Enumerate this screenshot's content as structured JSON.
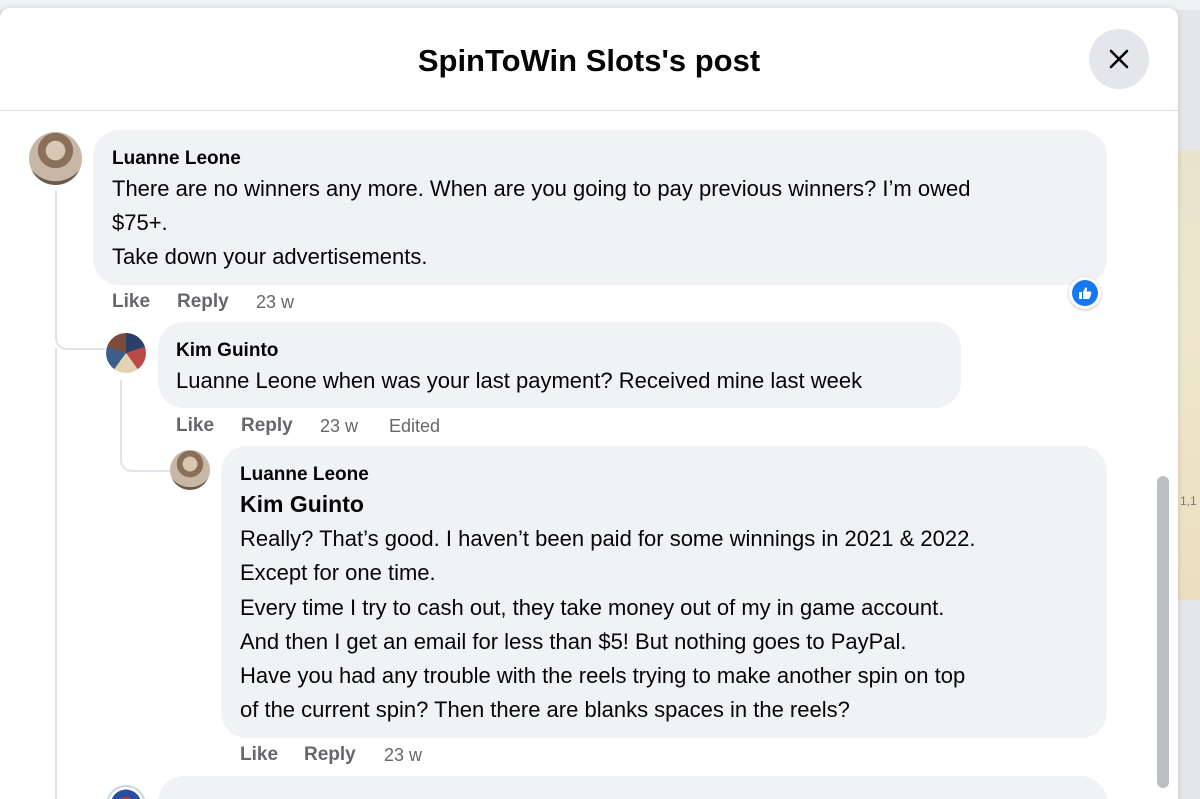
{
  "modal": {
    "title": "SpinToWin Slots's post"
  },
  "comments": [
    {
      "author": "Luanne Leone",
      "lines": [
        "There are no winners any more. When are you going to pay previous winners? I’m owed",
        "$75+.",
        "Take down your advertisements."
      ],
      "actions": {
        "like": "Like",
        "reply": "Reply"
      },
      "time": "23 w",
      "reaction": "like-reaction"
    },
    {
      "author": "Kim Guinto",
      "lines": [
        "Luanne Leone when was your last payment? Received mine last week"
      ],
      "actions": {
        "like": "Like",
        "reply": "Reply"
      },
      "time": "23 w",
      "edited": "Edited"
    },
    {
      "author": "Luanne Leone",
      "mention": "Kim Guinto",
      "lines": [
        "Really? That’s good. I haven’t been paid for some winnings in 2021 & 2022.",
        "Except for one time.",
        "Every time I try to cash out, they take money out of my in game account.",
        "And then I get an email for less than $5! But nothing goes to PayPal.",
        "Have you had any trouble with the reels trying to make another spin on top",
        "of the current spin? Then there are blanks spaces in the reels?"
      ],
      "actions": {
        "like": "Like",
        "reply": "Reply"
      },
      "time": "23 w"
    }
  ],
  "colors": {
    "bubble": "#f0f2f5",
    "secondary_text": "#65676b",
    "like_blue": "#1877f2"
  }
}
